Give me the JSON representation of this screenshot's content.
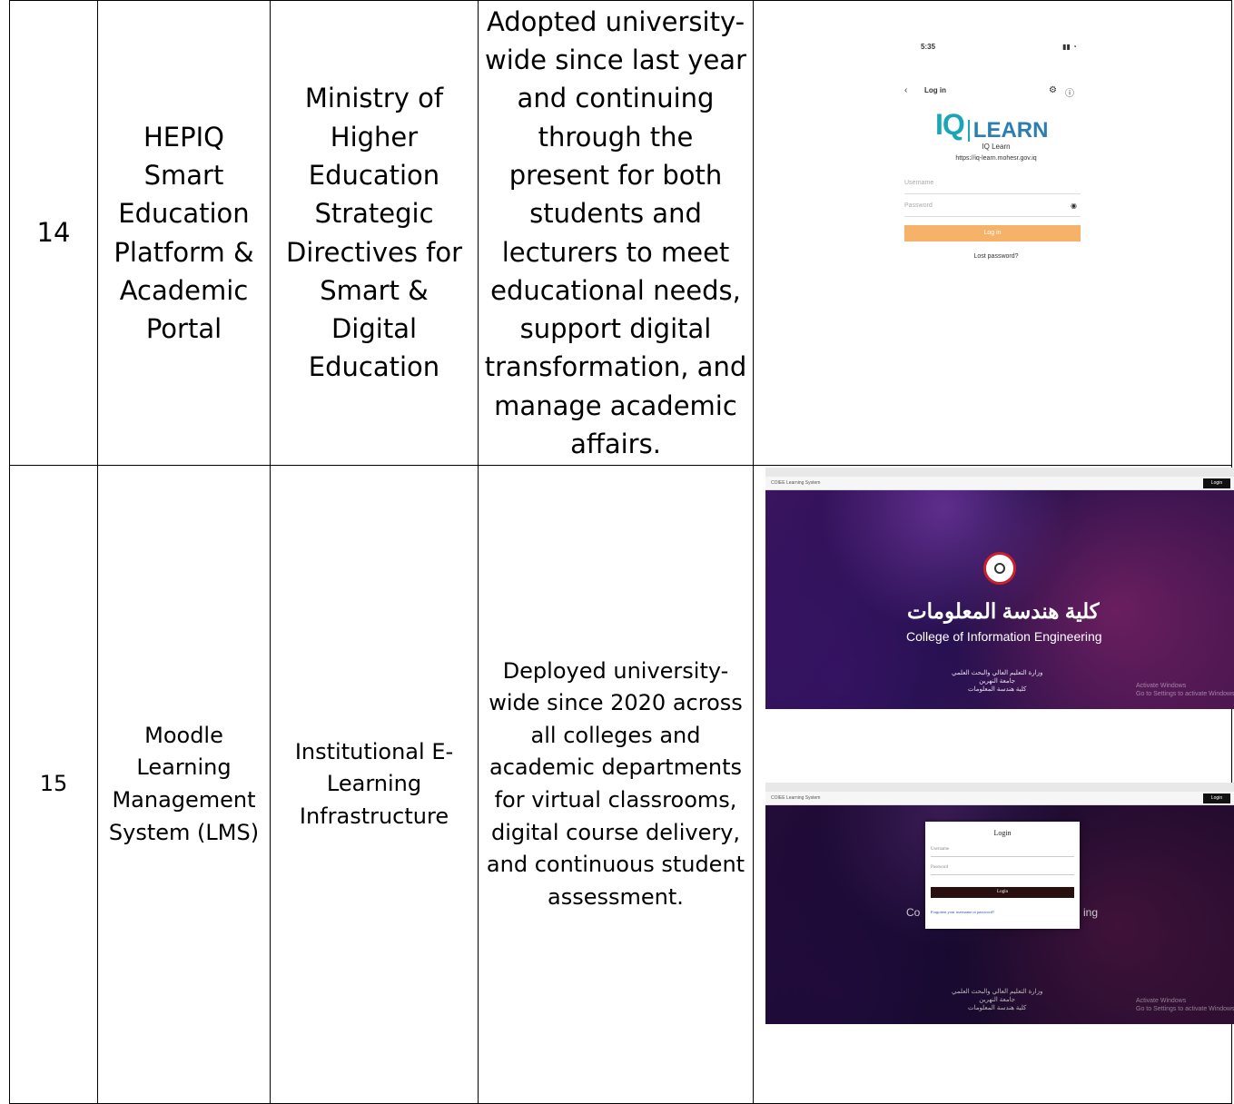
{
  "rows": [
    {
      "number": "14",
      "system": "HEPIQ Smart Education Platform & Academic Portal",
      "source": "Ministry of Higher Education Strategic Directives for Smart & Digital Education",
      "usage": "Adopted university-wide since last year and continuing through the present for both students and lecturers to meet educational needs, support digital transformation, and manage academic affairs.",
      "screenshot": {
        "status_time": "5:35",
        "nav_title": "Log in",
        "logo_iq": "IQ",
        "logo_learn": "LEARN",
        "site_name": "IQ Learn",
        "site_url": "https://iq-learn.mohesr.gov.iq",
        "username_placeholder": "Username",
        "password_placeholder": "Password",
        "login_button": "Log in",
        "lost_password": "Lost password?",
        "icons": [
          "back-icon",
          "gear-icon",
          "help-icon",
          "eye-icon"
        ]
      }
    },
    {
      "number": "15",
      "system": "Moodle Learning Management System (LMS)",
      "source": "Institutional E-Learning Infrastructure",
      "usage": "Deployed university-wide since 2020 across all colleges and academic departments for virtual classrooms, digital course delivery, and continuous student assessment.",
      "screenshot_top": {
        "site_tab": "COIEE Learning System",
        "login_button": "Login",
        "arabic_title": "كلية هندسة المعلومات",
        "english_title": "College of Information Engineering",
        "arabic_lines": [
          "وزارة التعليم العالي والبحث العلمي",
          "جامعة النهرين",
          "كلية هندسة المعلومات"
        ],
        "watermark": [
          "Activate Windows",
          "Go to Settings to activate Windows."
        ]
      },
      "screenshot_bottom": {
        "site_tab": "COIEE Learning System",
        "login_button": "Login",
        "modal_title": "Login",
        "username_placeholder": "Username",
        "password_placeholder": "Password",
        "modal_button": "Login",
        "forgot_link": "Forgotten your username or password?",
        "peek_left": "Co",
        "peek_right": "ing",
        "arabic_lines": [
          "وزارة التعليم العالي والبحث العلمي",
          "جامعة النهرين",
          "كلية هندسة المعلومات"
        ],
        "watermark": [
          "Activate Windows",
          "Go to Settings to activate Windows."
        ]
      }
    }
  ]
}
